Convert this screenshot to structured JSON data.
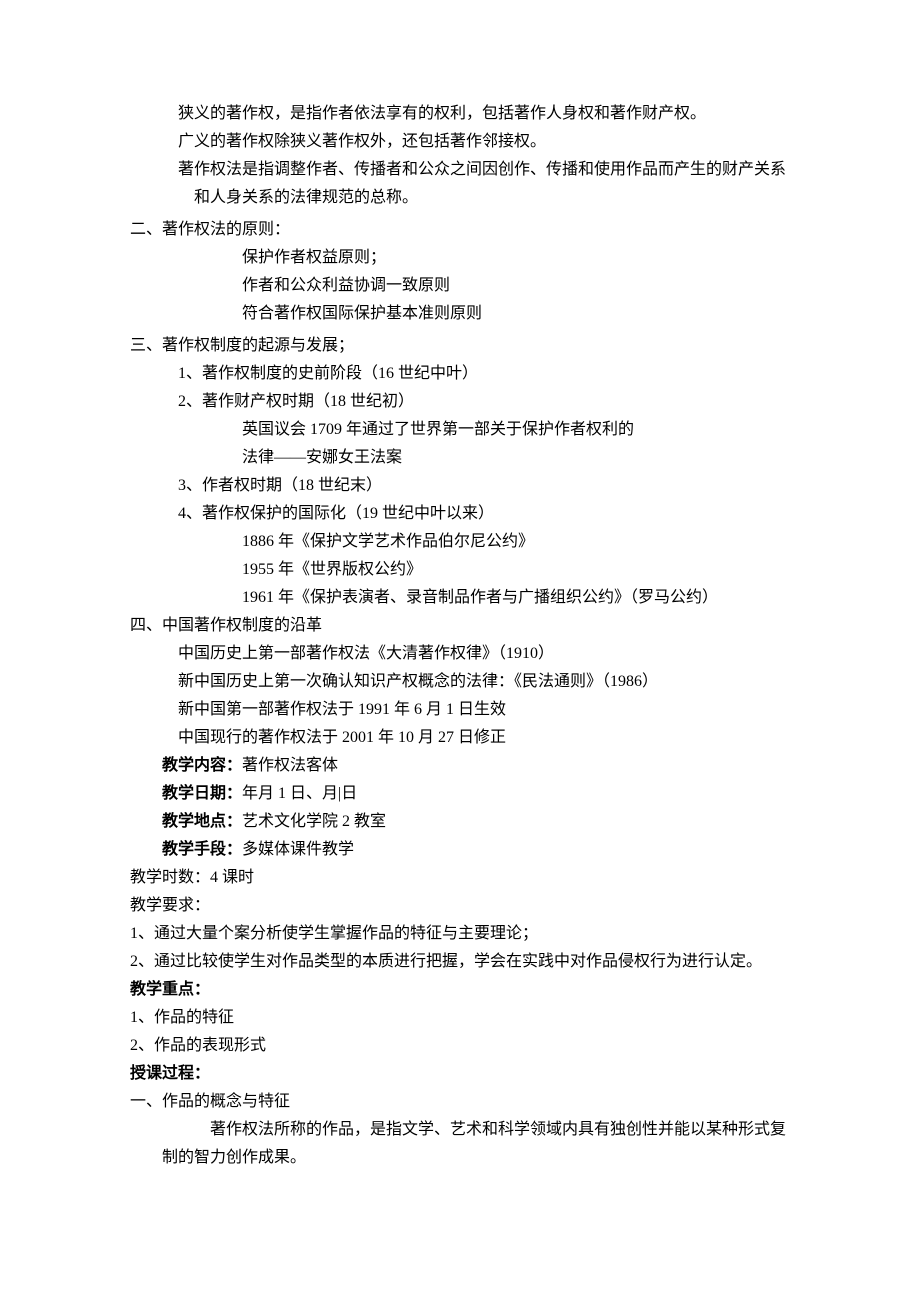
{
  "intro": {
    "line1": "狭义的著作权，是指作者依法享有的权利，包括著作人身权和著作财产权。",
    "line2": "广义的著作权除狭义著作权外，还包括著作邻接权。",
    "line3": "著作权法是指调整作者、传播者和公众之间因创作、传播和使用作品而产生的财产关系和人身关系的法律规范的总称。"
  },
  "sec2": {
    "title": "二、著作权法的原则：",
    "items": [
      "保护作者权益原则；",
      "作者和公众利益协调一致原则",
      "符合著作权国际保护基本准则原则"
    ]
  },
  "sec3": {
    "title": "三、著作权制度的起源与发展；",
    "item1": "1、著作权制度的史前阶段（16 世纪中叶）",
    "item2": "2、著作财产权时期（18 世纪初）",
    "item2_sub1": "英国议会 1709 年通过了世界第一部关于保护作者权利的",
    "item2_sub2": "法律——安娜女王法案",
    "item3": "3、作者权时期（18 世纪末）",
    "item4": "4、著作权保护的国际化（19 世纪中叶以来）",
    "item4_sub1": "1886 年《保护文学艺术作品伯尔尼公约》",
    "item4_sub2": "1955 年《世界版权公约》",
    "item4_sub3": "1961 年《保护表演者、录音制品作者与广播组织公约》（罗马公约）"
  },
  "sec4": {
    "title": "四、中国著作权制度的沿革",
    "line1": "中国历史上第一部著作权法《大清著作权律》（1910）",
    "line2": "新中国历史上第一次确认知识产权概念的法律：《民法通则》（1986）",
    "line3": "新中国第一部著作权法于 1991 年 6 月 1 日生效",
    "line4": "中国现行的著作权法于 2001 年 10 月 27 日修正"
  },
  "teach": {
    "content_label": "教学内容：",
    "content_value": "著作权法客体",
    "date_label": "教学日期：",
    "date_value": "年月 1 日、月|日",
    "place_label": "教学地点：",
    "place_value": "艺术文化学院 2 教室",
    "method_label": "教学手段：",
    "method_value": "多媒体课件教学",
    "hours": "教学时数：4 课时",
    "req_title": "教学要求：",
    "req1": "1、通过大量个案分析使学生掌握作品的特征与主要理论；",
    "req2": "2、通过比较使学生对作品类型的本质进行把握，学会在实践中对作品侵权行为进行认定。",
    "focus_title": "教学重点：",
    "focus1": "1、作品的特征",
    "focus2": "2、作品的表现形式",
    "process_title": "授课过程："
  },
  "sec1b": {
    "title": "一、作品的概念与特征",
    "body": "著作权法所称的作品，是指文学、艺术和科学领域内具有独创性并能以某种形式复制的智力创作成果。"
  }
}
